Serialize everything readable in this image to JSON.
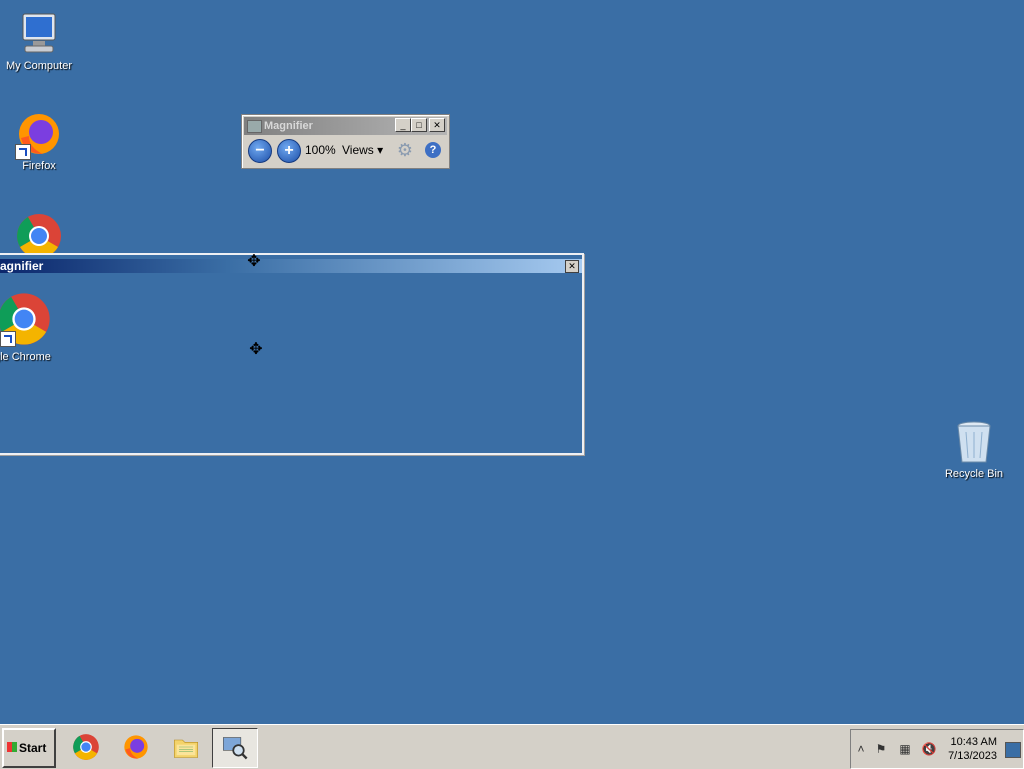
{
  "desktop": {
    "icons": {
      "my_computer": "My Computer",
      "firefox": "Firefox",
      "recycle_bin": "Recycle Bin"
    }
  },
  "magnifier_toolbar": {
    "title": "Magnifier",
    "zoom_out_glyph": "−",
    "zoom_in_glyph": "+",
    "zoom_level": "100%",
    "views_label": "Views ▾",
    "minimize_glyph": "_",
    "maximize_glyph": "□",
    "close_glyph": "✕",
    "help_glyph": "?",
    "gear_glyph": "⚙"
  },
  "lens_window": {
    "title": "agnifier",
    "close_glyph": "✕",
    "magnified_icon_label": "gle Chrome"
  },
  "taskbar": {
    "start_label": "Start",
    "apps": [
      "chrome-icon",
      "firefox-icon",
      "file-explorer-icon",
      "magnifier-icon"
    ],
    "tray_expand_glyph": "˄",
    "clock_time": "10:43 AM",
    "clock_date": "7/13/2023"
  },
  "colors": {
    "desktop": "#3a6ea5",
    "taskbar": "#d4d0c8"
  }
}
